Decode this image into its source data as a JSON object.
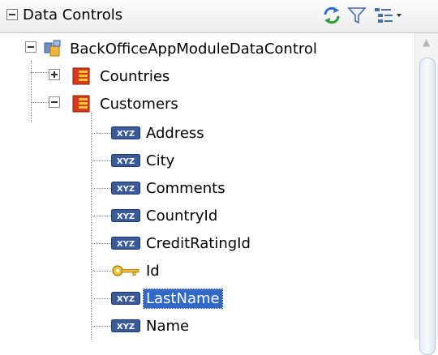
{
  "panel": {
    "title": "Data Controls",
    "toolbar_icons": [
      "refresh-icon",
      "filter-icon",
      "layout-options-icon"
    ]
  },
  "tree": {
    "root": {
      "label": "BackOfficeAppModuleDataControl",
      "icon": "data-control-icon",
      "expanded": true
    },
    "collections": [
      {
        "label": "Countries",
        "icon": "collection-icon",
        "expanded": false
      },
      {
        "label": "Customers",
        "icon": "collection-icon",
        "expanded": true
      }
    ],
    "attributes": [
      {
        "label": "Address",
        "icon": "attribute-xyz-icon"
      },
      {
        "label": "City",
        "icon": "attribute-xyz-icon"
      },
      {
        "label": "Comments",
        "icon": "attribute-xyz-icon"
      },
      {
        "label": "CountryId",
        "icon": "attribute-xyz-icon"
      },
      {
        "label": "CreditRatingId",
        "icon": "attribute-xyz-icon"
      },
      {
        "label": "Id",
        "icon": "key-icon"
      },
      {
        "label": "LastName",
        "icon": "attribute-xyz-icon",
        "selected": true
      },
      {
        "label": "Name",
        "icon": "attribute-xyz-icon"
      }
    ]
  },
  "colors": {
    "selection": "#3169c6",
    "collection_icon": "#d83a1a"
  }
}
